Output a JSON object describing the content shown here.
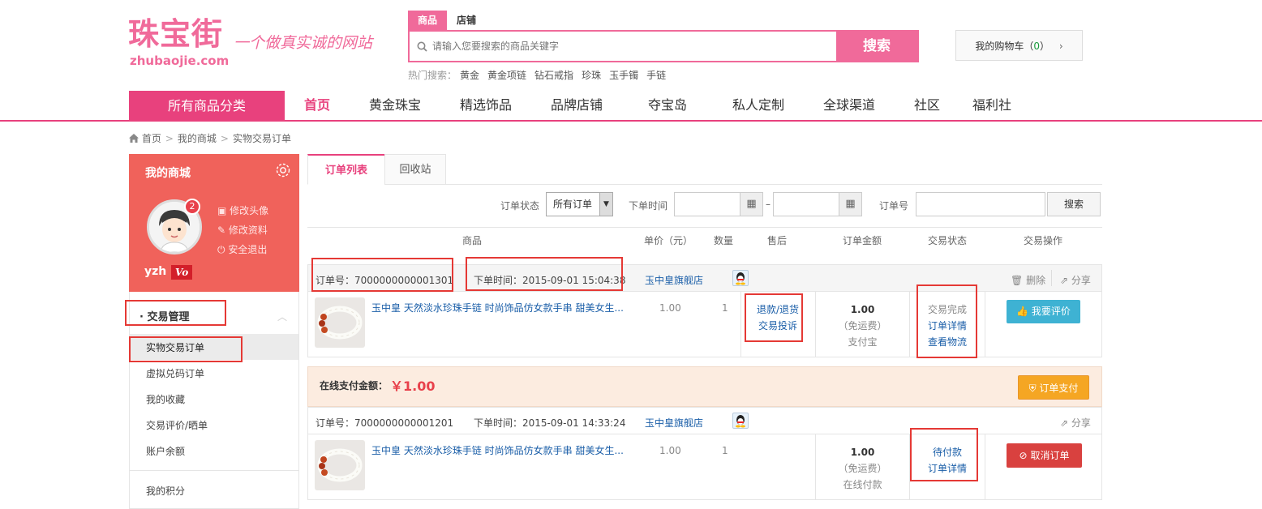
{
  "header": {
    "logo_cn": "珠宝街",
    "logo_en": "zhubaojie.com",
    "slogan": "一个做真实诚的网站",
    "search_tabs": [
      "商品",
      "店铺"
    ],
    "search_placeholder": "请输入您要搜索的商品关键字",
    "search_button": "搜索",
    "hot_label": "热门搜索：",
    "hot_terms": [
      "黄金",
      "黄金项链",
      "钻石戒指",
      "珍珠",
      "玉手镯",
      "手链"
    ],
    "cart_label": "我的购物车（",
    "cart_count": "0",
    "cart_close": "）",
    "cart_arrow": "›"
  },
  "nav": {
    "all_categories": "所有商品分类",
    "items": [
      "首页",
      "黄金珠宝",
      "精选饰品",
      "品牌店铺",
      "夺宝岛",
      "私人定制",
      "全球渠道",
      "社区",
      "福利社"
    ]
  },
  "breadcrumb": [
    "首页",
    "我的商城",
    "实物交易订单"
  ],
  "sidebar": {
    "title": "我的商城",
    "badge": "2",
    "links": [
      "修改头像",
      "修改资料",
      "安全退出"
    ],
    "username": "yzh",
    "vip": "Vo",
    "group": "· 交易管理",
    "items": [
      "实物交易订单",
      "虚拟兑码订单",
      "我的收藏",
      "交易评价/晒单",
      "账户余额",
      "我的积分"
    ]
  },
  "tabs": [
    "订单列表",
    "回收站"
  ],
  "filter": {
    "status_label": "订单状态",
    "status_value": "所有订单",
    "time_label": "下单时间",
    "dash": "–",
    "order_label": "订单号",
    "search_button": "搜索"
  },
  "table_headers": [
    "商品",
    "单价（元）",
    "数量",
    "售后",
    "订单金额",
    "交易状态",
    "交易操作"
  ],
  "orders": [
    {
      "order_no": "订单号：7000000000001301",
      "order_time": "下单时间：2015-09-01 15:04:38",
      "shop": "玉中皇旗舰店",
      "actions": [
        "删除",
        "分享"
      ],
      "product": "玉中皇 天然淡水珍珠手链 时尚饰品仿女款手串 甜美女生...",
      "price": "1.00",
      "qty": "1",
      "after_sale": [
        "退款/退货",
        "交易投诉"
      ],
      "amount": "1.00",
      "shipping": "（免运费）",
      "pay_method": "支付宝",
      "status": [
        "交易完成",
        "订单详情",
        "查看物流"
      ],
      "op_button": "我要评价"
    },
    {
      "pay_label": "在线支付金额：",
      "pay_amount": "￥1.00",
      "pay_button": "订单支付",
      "order_no": "订单号：7000000000001201",
      "order_time": "下单时间：2015-09-01 14:33:24",
      "shop": "玉中皇旗舰店",
      "actions": [
        "分享"
      ],
      "product": "玉中皇 天然淡水珍珠手链 时尚饰品仿女款手串 甜美女生...",
      "price": "1.00",
      "qty": "1",
      "amount": "1.00",
      "shipping": "（免运费）",
      "pay_method": "在线付款",
      "status": [
        "待付款",
        "订单详情"
      ],
      "op_button": "取消订单"
    }
  ],
  "colors": {
    "brand": "#e8417d",
    "sidebar": "#f0625b",
    "link": "#1a5ea8",
    "highlight": "#e53935"
  }
}
